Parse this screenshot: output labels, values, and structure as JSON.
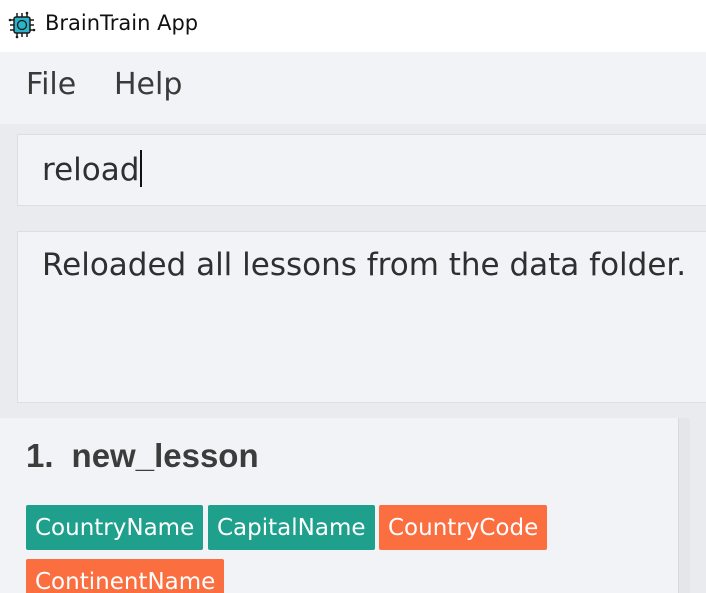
{
  "window": {
    "title": "BrainTrain App",
    "app_icon": "brain-chip-icon"
  },
  "menu": {
    "items": [
      "File",
      "Help"
    ]
  },
  "command": {
    "value": "reload"
  },
  "result": {
    "message": "Reloaded all lessons from the data folder."
  },
  "lessons": [
    {
      "index": "1.",
      "name": "new_lesson",
      "tags": [
        {
          "label": "CountryName",
          "color": "#1fa08c"
        },
        {
          "label": "CapitalName",
          "color": "#1fa08c"
        },
        {
          "label": "CountryCode",
          "color": "#fb6e3f"
        },
        {
          "label": "ContinentName",
          "color": "#fb6e3f"
        }
      ]
    }
  ]
}
